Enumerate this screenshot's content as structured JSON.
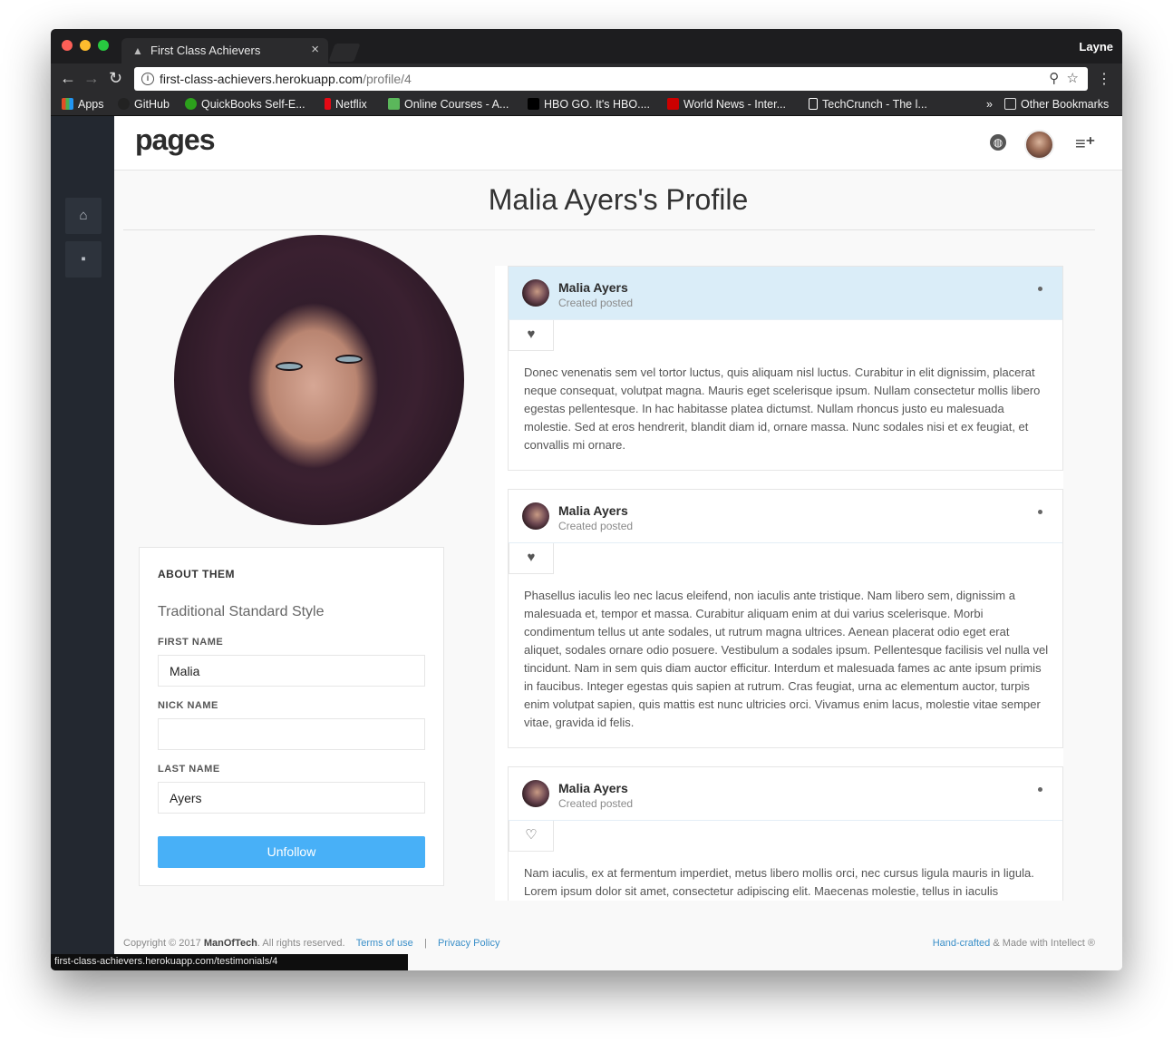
{
  "browser": {
    "tab_title": "First Class Achievers",
    "tab_close": "×",
    "profile_name": "Layne",
    "url_host": "first-class-achievers.herokuapp.com",
    "url_path": "/profile/4",
    "bookmarks": [
      {
        "label": "Apps",
        "color": "#e44d26"
      },
      {
        "label": "GitHub",
        "color": "#222222"
      },
      {
        "label": "QuickBooks Self-E...",
        "color": "#2ca01c"
      },
      {
        "label": "Netflix",
        "color": "#e50914"
      },
      {
        "label": "Online Courses - A...",
        "color": "#5bb75b"
      },
      {
        "label": "HBO GO. It's HBO....",
        "color": "#000000"
      },
      {
        "label": "World News - Inter...",
        "color": "#cc0000"
      },
      {
        "label": "TechCrunch - The l...",
        "color": "#ffffff"
      }
    ],
    "bookmarks_overflow": "»",
    "other_bookmarks": "Other Bookmarks",
    "status_url": "first-class-achievers.herokuapp.com/testimonials/4"
  },
  "app": {
    "logo": "pages",
    "page_title": "Malia Ayers's Profile",
    "about": {
      "heading": "ABOUT THEM",
      "subtitle": "Traditional Standard Style",
      "first_name_label": "FIRST NAME",
      "first_name_value": "Malia",
      "nick_name_label": "NICK NAME",
      "nick_name_value": "",
      "last_name_label": "LAST NAME",
      "last_name_value": "Ayers",
      "unfollow_label": "Unfollow"
    },
    "posts": [
      {
        "author": "Malia Ayers",
        "meta": "Created posted",
        "body": "Donec venenatis sem vel tortor luctus, quis aliquam nisl luctus. Curabitur in elit dignissim, placerat neque consequat, volutpat magna. Mauris eget scelerisque ipsum. Nullam consectetur mollis libero egestas pellentesque. In hac habitasse platea dictumst. Nullam rhoncus justo eu malesuada molestie. Sed at eros hendrerit, blandit diam id, ornare massa. Nunc sodales nisi et ex feugiat, et convallis mi ornare.",
        "liked": true
      },
      {
        "author": "Malia Ayers",
        "meta": "Created posted",
        "body": "Phasellus iaculis leo nec lacus eleifend, non iaculis ante tristique. Nam libero sem, dignissim a malesuada et, tempor et massa. Curabitur aliquam enim at dui varius scelerisque. Morbi condimentum tellus ut ante sodales, ut rutrum magna ultrices. Aenean placerat odio eget erat aliquet, sodales ornare odio posuere. Vestibulum a sodales ipsum. Pellentesque facilisis vel nulla vel tincidunt. Nam in sem quis diam auctor efficitur. Interdum et malesuada fames ac ante ipsum primis in faucibus. Integer egestas quis sapien at rutrum. Cras feugiat, urna ac elementum auctor, turpis enim volutpat sapien, quis mattis est nunc ultricies orci. Vivamus enim lacus, molestie vitae semper vitae, gravida id felis.",
        "liked": true
      },
      {
        "author": "Malia Ayers",
        "meta": "Created posted",
        "body": "Nam iaculis, ex at fermentum imperdiet, metus libero mollis orci, nec cursus ligula mauris in ligula. Lorem ipsum dolor sit amet, consectetur adipiscing elit. Maecenas molestie, tellus in iaculis",
        "liked": false
      }
    ],
    "footer": {
      "copyright_prefix": "Copyright © 2017",
      "company": "ManOfTech",
      "rights": ". All rights reserved.",
      "terms": "Terms of use",
      "separator": "|",
      "privacy": "Privacy Policy",
      "crafted_link": "Hand-crafted",
      "crafted_rest": "& Made with Intellect ®"
    }
  },
  "colors": {
    "accent": "#48b0f7",
    "sidebar": "#232830",
    "active_post": "#daedf8"
  }
}
